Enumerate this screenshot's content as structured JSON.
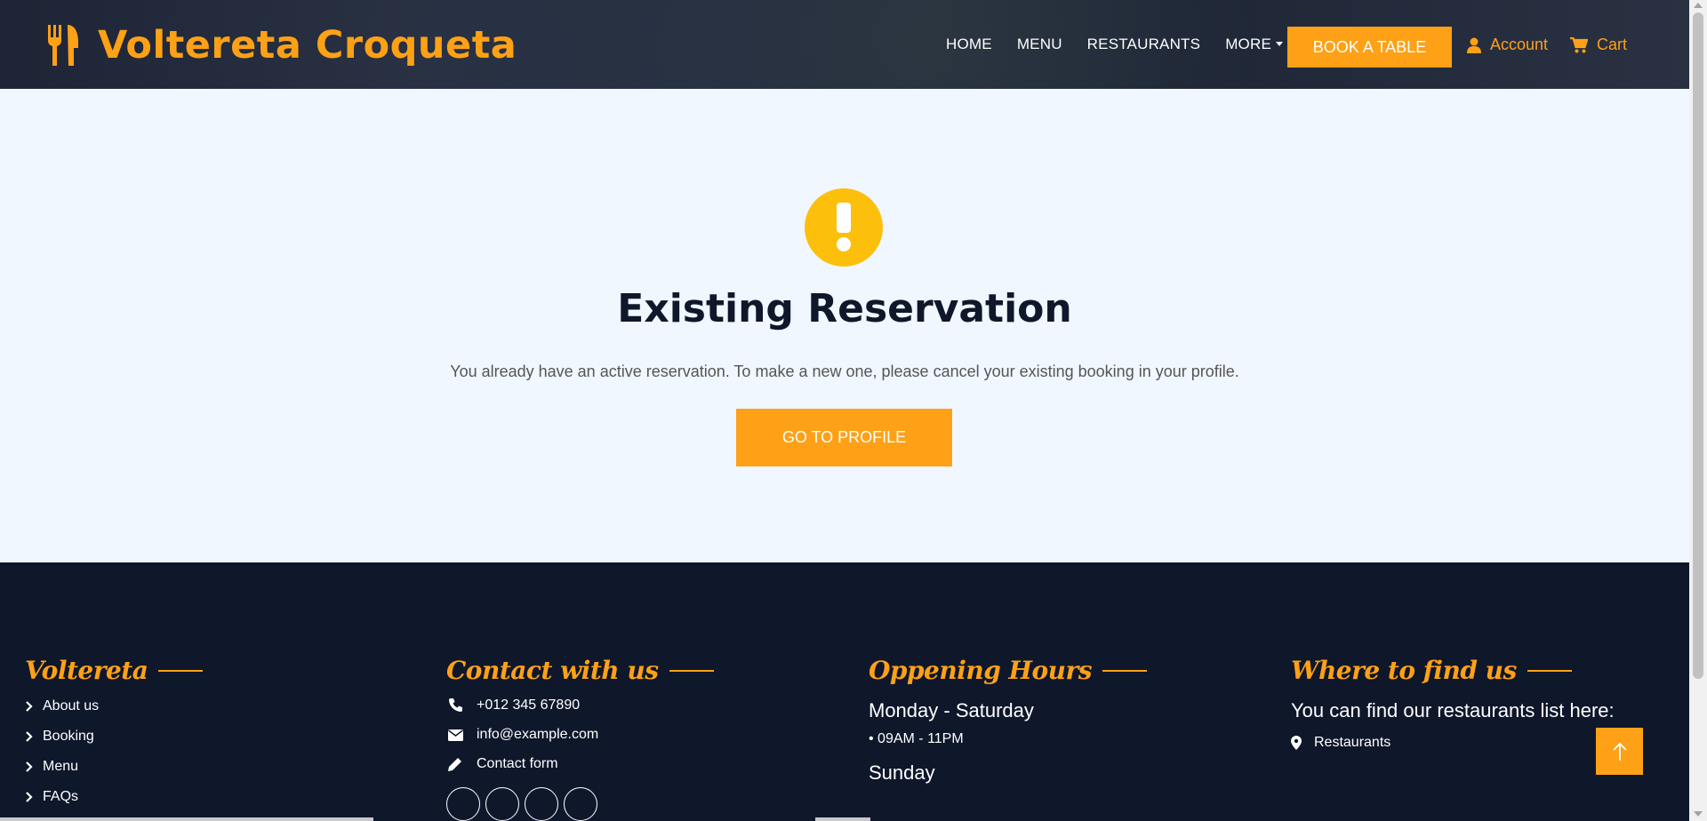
{
  "header": {
    "brand": "Voltereta Croqueta",
    "nav": [
      {
        "label": "HOME"
      },
      {
        "label": "MENU"
      },
      {
        "label": "RESTAURANTS"
      },
      {
        "label": "MORE"
      }
    ],
    "book_label": "BOOK A TABLE",
    "account_label": "Account",
    "cart_label": "Cart"
  },
  "main": {
    "icon": "exclamation-icon",
    "title": "Existing Reservation",
    "message": "You already have an active reservation. To make a new one, please cancel your existing booking in your profile.",
    "button_label": "GO TO PROFILE"
  },
  "footer": {
    "col1": {
      "title": "Voltereta",
      "links": [
        "About us",
        "Booking",
        "Menu",
        "FAQs"
      ]
    },
    "col2": {
      "title": "Contact with us",
      "phone": "+012 345 67890",
      "email": "info@example.com",
      "form": "Contact form"
    },
    "col3": {
      "title": "Oppening Hours",
      "day1": "Monday - Saturday",
      "time1": "09AM - 11PM",
      "day2": "Sunday"
    },
    "col4": {
      "title": "Where to find us",
      "text": "You can find our restaurants list here:",
      "link": "Restaurants"
    }
  },
  "colors": {
    "accent": "#fea116",
    "dark": "#0f172b",
    "warning": "#fcc00c"
  }
}
